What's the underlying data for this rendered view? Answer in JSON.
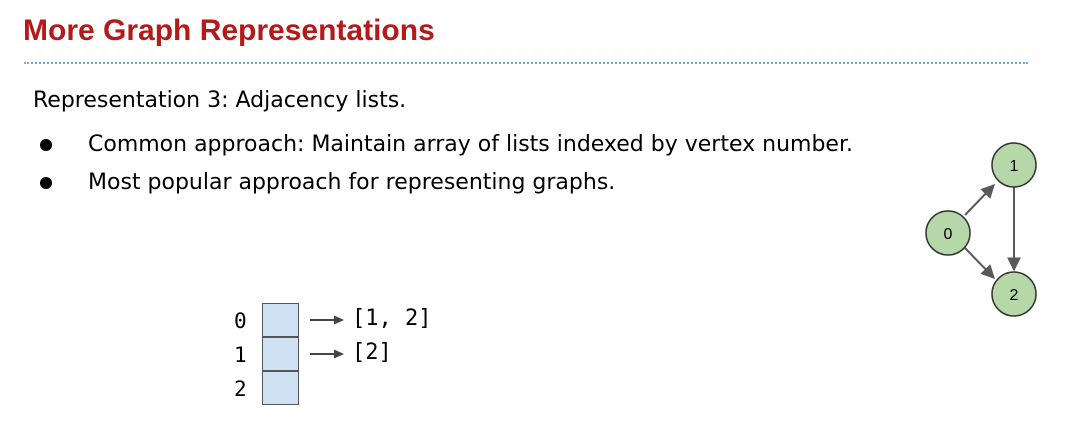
{
  "slide": {
    "title": "More Graph Representations",
    "subtitle": "Representation 3: Adjacency lists.",
    "bullets": [
      "Common approach: Maintain array of lists indexed by vertex number.",
      "Most popular approach for representing graphs."
    ]
  },
  "adjacency": {
    "rows": [
      {
        "index": "0",
        "list": "[1, 2]"
      },
      {
        "index": "1",
        "list": "[2]"
      },
      {
        "index": "2",
        "list": ""
      }
    ]
  },
  "graph": {
    "nodes": [
      "0",
      "1",
      "2"
    ],
    "edges": [
      {
        "from": "0",
        "to": "1"
      },
      {
        "from": "0",
        "to": "2"
      },
      {
        "from": "1",
        "to": "2"
      }
    ],
    "node_color": "#b6d7a8",
    "edge_color": "#595959"
  },
  "colors": {
    "title": "#b51a1a",
    "rule": "#6fa8dc",
    "cell": "#cfe2f3"
  }
}
